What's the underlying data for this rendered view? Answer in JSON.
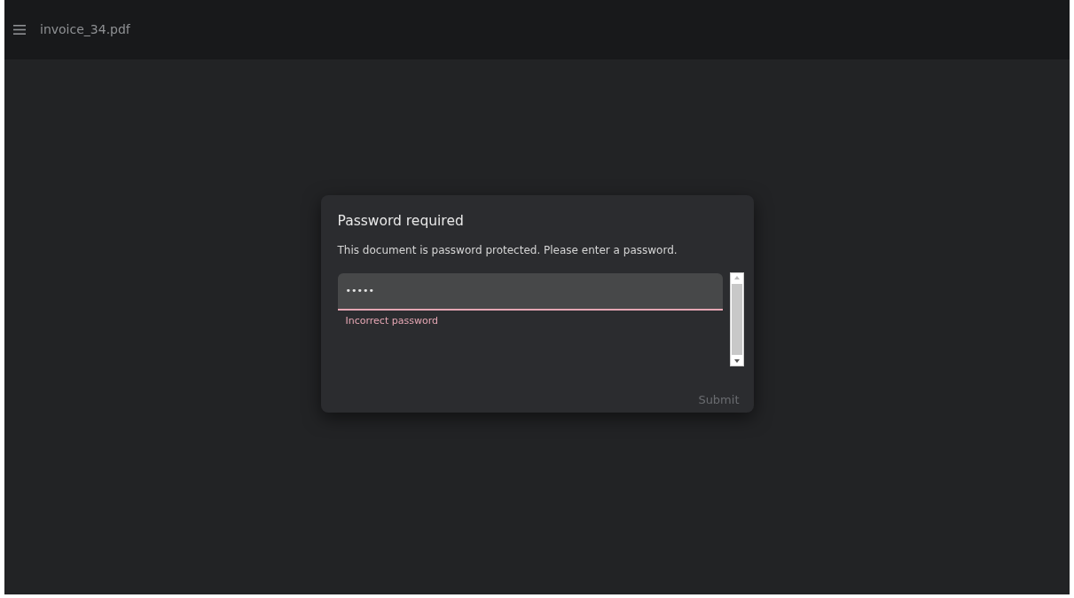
{
  "toolbar": {
    "title": "invoice_34.pdf"
  },
  "dialog": {
    "title": "Password required",
    "message": "This document is password protected. Please enter a password.",
    "password": {
      "value": "•••••",
      "invalid": true,
      "error": "Incorrect password"
    },
    "submit": {
      "label": "Submit",
      "disabled": true
    }
  }
}
